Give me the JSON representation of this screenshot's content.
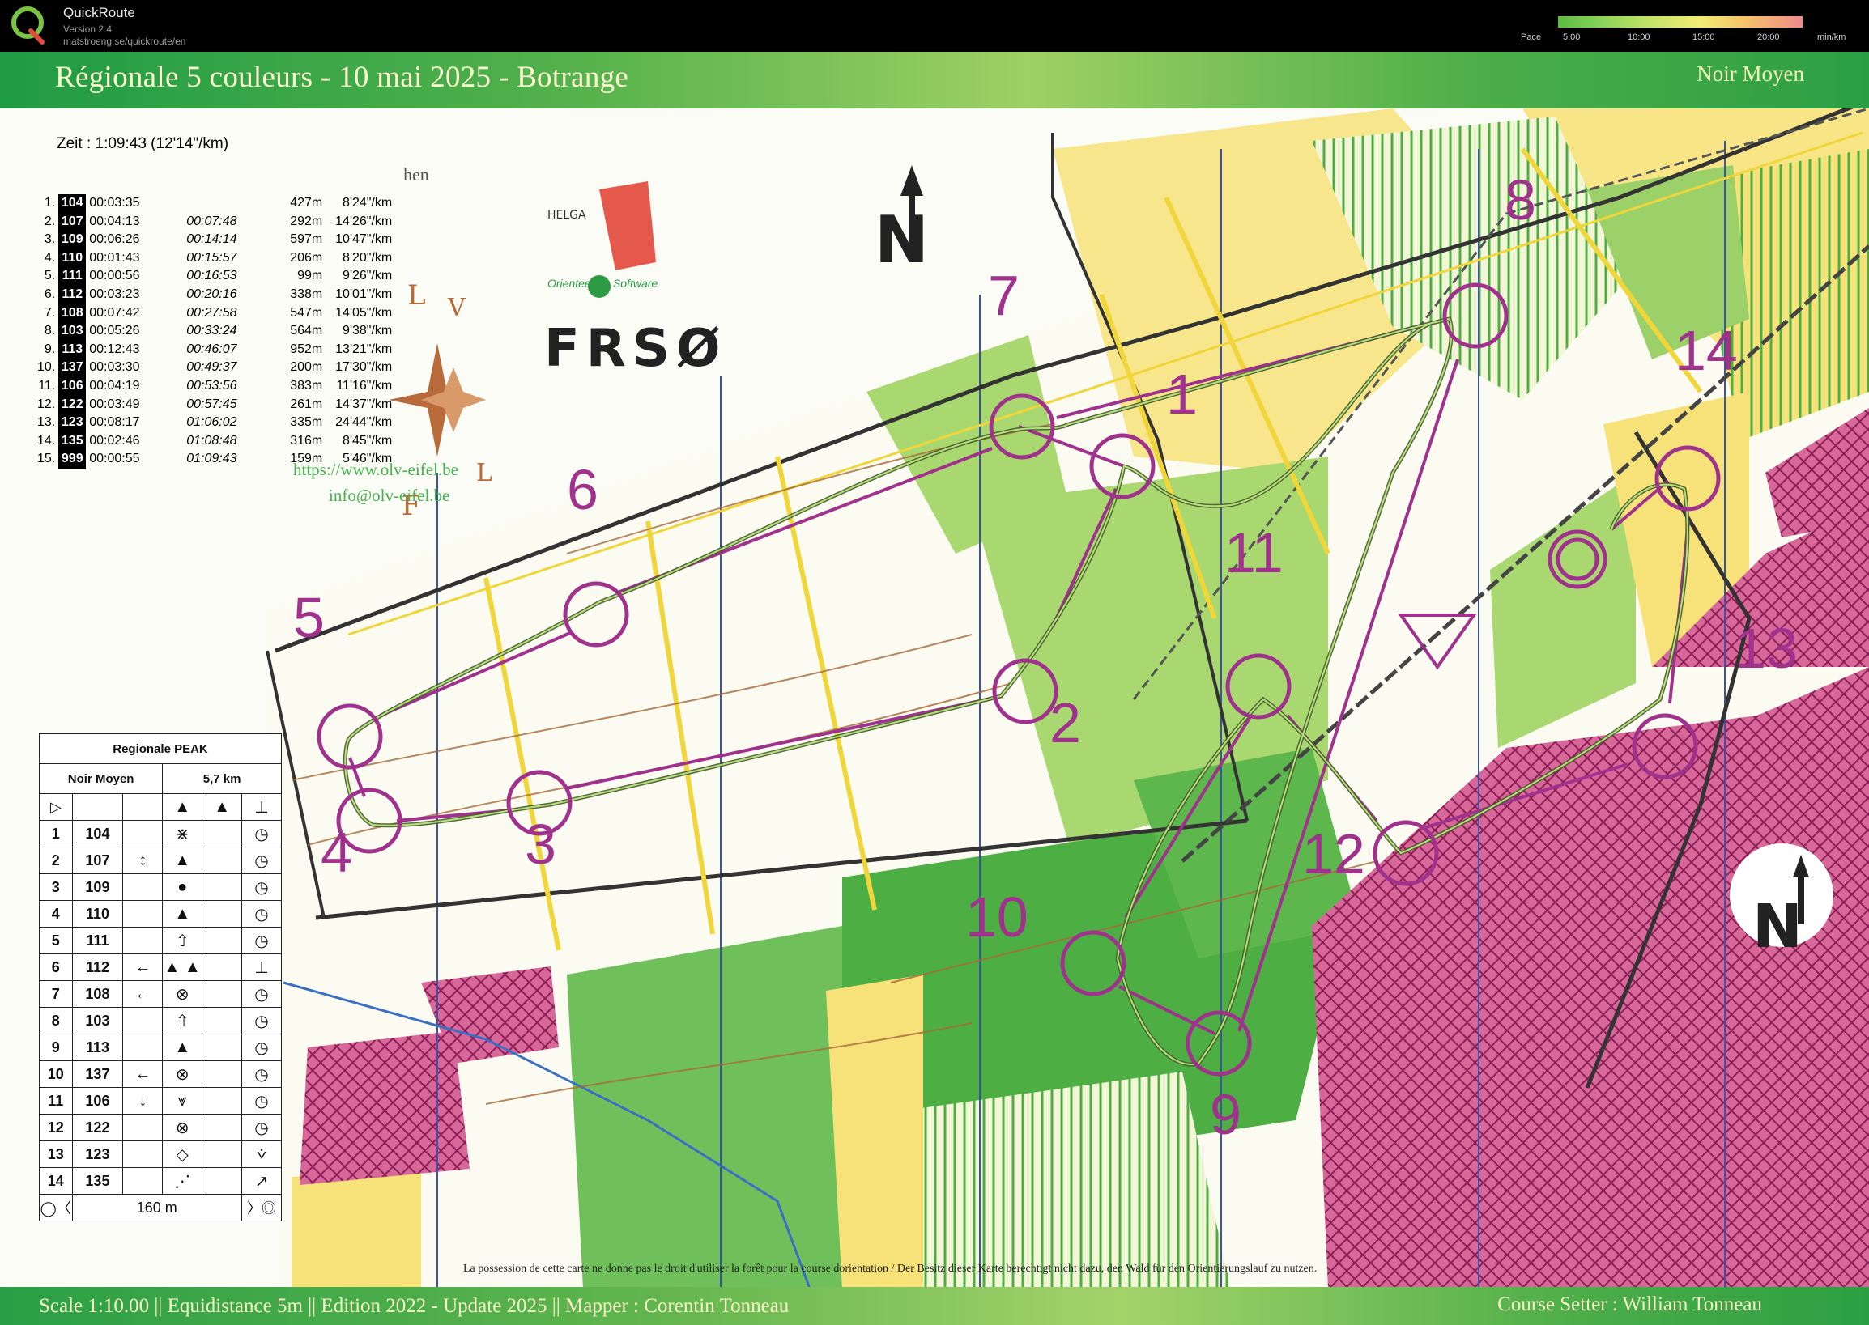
{
  "app": {
    "title": "QuickRoute",
    "version": "Version 2.4",
    "url": "matstroeng.se/quickroute/en",
    "pace_legend": {
      "label": "Pace",
      "ticks": [
        "5:00",
        "10:00",
        "15:00",
        "20:00"
      ],
      "unit": "min/km"
    }
  },
  "map": {
    "title": "Régionale 5 couleurs - 10 mai 2025 - Botrange",
    "course_class": "Noir Moyen",
    "footer_left": "Scale 1:10.00 || Equidistance 5m || Edition 2022 - Update 2025 || Mapper : Corentin Tonneau",
    "footer_right": "Course Setter : William Tonneau",
    "disclaimer": "La possession de cette carte ne donne pas le droit d'utiliser la forêt pour la course dorientation / Der Besitz dieser Karte berechtigt nicht dazu, den Wald für den Orientierungslauf zu nutzen.",
    "club_url": "https://www.olv-eifel.be",
    "club_email": "info@olv-eifel.be",
    "club_fragment": "hen",
    "federation": "FRSØ",
    "software_name": "HELGA",
    "software_caption": "Orienteering Software",
    "controls": [
      "1",
      "2",
      "3",
      "4",
      "5",
      "6",
      "7",
      "8",
      "9",
      "10",
      "11",
      "12",
      "13",
      "14"
    ]
  },
  "result": {
    "summary": "Zeit : 1:09:43 (12'14\"/km)",
    "splits": [
      {
        "n": "1.",
        "code": "104",
        "leg": "00:03:35",
        "cum": "",
        "dist": "427m",
        "pace": "8'24\"/km"
      },
      {
        "n": "2.",
        "code": "107",
        "leg": "00:04:13",
        "cum": "00:07:48",
        "dist": "292m",
        "pace": "14'26\"/km"
      },
      {
        "n": "3.",
        "code": "109",
        "leg": "00:06:26",
        "cum": "00:14:14",
        "dist": "597m",
        "pace": "10'47\"/km"
      },
      {
        "n": "4.",
        "code": "110",
        "leg": "00:01:43",
        "cum": "00:15:57",
        "dist": "206m",
        "pace": "8'20\"/km"
      },
      {
        "n": "5.",
        "code": "111",
        "leg": "00:00:56",
        "cum": "00:16:53",
        "dist": "99m",
        "pace": "9'26\"/km"
      },
      {
        "n": "6.",
        "code": "112",
        "leg": "00:03:23",
        "cum": "00:20:16",
        "dist": "338m",
        "pace": "10'01\"/km"
      },
      {
        "n": "7.",
        "code": "108",
        "leg": "00:07:42",
        "cum": "00:27:58",
        "dist": "547m",
        "pace": "14'05\"/km"
      },
      {
        "n": "8.",
        "code": "103",
        "leg": "00:05:26",
        "cum": "00:33:24",
        "dist": "564m",
        "pace": "9'38\"/km"
      },
      {
        "n": "9.",
        "code": "113",
        "leg": "00:12:43",
        "cum": "00:46:07",
        "dist": "952m",
        "pace": "13'21\"/km"
      },
      {
        "n": "10.",
        "code": "137",
        "leg": "00:03:30",
        "cum": "00:49:37",
        "dist": "200m",
        "pace": "17'30\"/km"
      },
      {
        "n": "11.",
        "code": "106",
        "leg": "00:04:19",
        "cum": "00:53:56",
        "dist": "383m",
        "pace": "11'16\"/km"
      },
      {
        "n": "12.",
        "code": "122",
        "leg": "00:03:49",
        "cum": "00:57:45",
        "dist": "261m",
        "pace": "14'37\"/km"
      },
      {
        "n": "13.",
        "code": "123",
        "leg": "00:08:17",
        "cum": "01:06:02",
        "dist": "335m",
        "pace": "24'44\"/km"
      },
      {
        "n": "14.",
        "code": "135",
        "leg": "00:02:46",
        "cum": "01:08:48",
        "dist": "316m",
        "pace": "8'45\"/km"
      },
      {
        "n": "15.",
        "code": "999",
        "leg": "00:00:55",
        "cum": "01:09:43",
        "dist": "159m",
        "pace": "5'46\"/km"
      }
    ]
  },
  "descriptions": {
    "event": "Regionale PEAK",
    "course": "Noir Moyen",
    "length": "5,7 km",
    "finish_distance": "160 m",
    "rows": [
      {
        "n": "1",
        "code": "104",
        "c1": "",
        "c2": "⋇",
        "c3": "◷"
      },
      {
        "n": "2",
        "code": "107",
        "c1": "↕",
        "c2": "▲",
        "c3": "◷"
      },
      {
        "n": "3",
        "code": "109",
        "c1": "",
        "c2": "●",
        "c3": "◷"
      },
      {
        "n": "4",
        "code": "110",
        "c1": "",
        "c2": "▲",
        "c3": "◷"
      },
      {
        "n": "5",
        "code": "111",
        "c1": "",
        "c2": "⇧",
        "c3": "◷"
      },
      {
        "n": "6",
        "code": "112",
        "c1": "←",
        "c2": "▲ ▲",
        "c3": "⊥"
      },
      {
        "n": "7",
        "code": "108",
        "c1": "←",
        "c2": "⊗",
        "c3": "◷"
      },
      {
        "n": "8",
        "code": "103",
        "c1": "",
        "c2": "⇧",
        "c3": "◷"
      },
      {
        "n": "9",
        "code": "113",
        "c1": "",
        "c2": "▲",
        "c3": "◷"
      },
      {
        "n": "10",
        "code": "137",
        "c1": "←",
        "c2": "⊗",
        "c3": "◷"
      },
      {
        "n": "11",
        "code": "106",
        "c1": "↓",
        "c2": "⩔",
        "c3": "◷"
      },
      {
        "n": "12",
        "code": "122",
        "c1": "",
        "c2": "⊗",
        "c3": "◷"
      },
      {
        "n": "13",
        "code": "123",
        "c1": "",
        "c2": "◇",
        "c3": "⩒"
      },
      {
        "n": "14",
        "code": "135",
        "c1": "",
        "c2": "⋰",
        "c3": "↗"
      }
    ]
  },
  "colors": {
    "forest_green": "#4dae44",
    "light_green": "#a8d86f",
    "open_yellow": "#f7e27a",
    "control_purple": "#a0328d",
    "route_dark": "#3e4a2a",
    "private_hatch": "#c23f7a"
  }
}
